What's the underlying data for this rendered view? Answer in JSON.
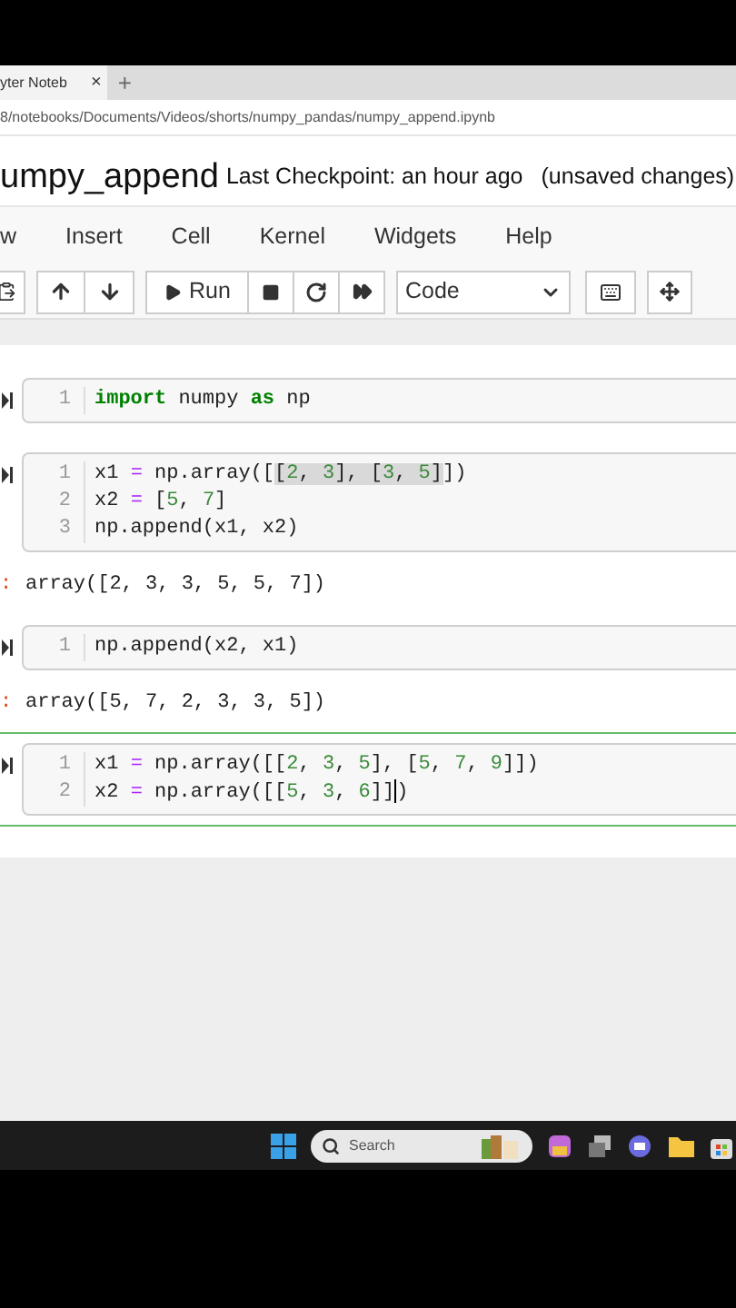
{
  "browser": {
    "tab": {
      "title": "yter Noteb",
      "close": "×"
    },
    "new_tab": "+",
    "url": "8/notebooks/Documents/Videos/shorts/numpy_pandas/numpy_append.ipynb"
  },
  "header": {
    "notebook_name": "umpy_append",
    "checkpoint": "Last Checkpoint: an hour ago",
    "status": "(unsaved changes)"
  },
  "menu": [
    "w",
    "Insert",
    "Cell",
    "Kernel",
    "Widgets",
    "Help"
  ],
  "toolbar": {
    "run_label": "Run",
    "cell_type": "Code"
  },
  "cells": [
    {
      "selected": false,
      "lines": [
        {
          "number": "1",
          "tokens": [
            {
              "kind": "keyword",
              "text": "import"
            },
            {
              "kind": "plain",
              "text": " numpy "
            },
            {
              "kind": "keyword",
              "text": "as"
            },
            {
              "kind": "plain",
              "text": " np"
            }
          ]
        }
      ]
    },
    {
      "selected": false,
      "lines": [
        {
          "number": "1",
          "tokens": [
            {
              "kind": "plain",
              "text": "x1 "
            },
            {
              "kind": "operator",
              "text": "="
            },
            {
              "kind": "plain",
              "text": " np.array(["
            },
            {
              "kind": "selection",
              "children": [
                {
                  "kind": "plain",
                  "text": "["
                },
                {
                  "kind": "number",
                  "text": "2"
                },
                {
                  "kind": "plain",
                  "text": ", "
                },
                {
                  "kind": "number",
                  "text": "3"
                },
                {
                  "kind": "plain",
                  "text": "], ["
                },
                {
                  "kind": "number",
                  "text": "3"
                },
                {
                  "kind": "plain",
                  "text": ", "
                },
                {
                  "kind": "number",
                  "text": "5"
                },
                {
                  "kind": "plain",
                  "text": "]"
                }
              ]
            },
            {
              "kind": "plain",
              "text": "])"
            }
          ]
        },
        {
          "number": "2",
          "tokens": [
            {
              "kind": "plain",
              "text": "x2 "
            },
            {
              "kind": "operator",
              "text": "="
            },
            {
              "kind": "plain",
              "text": " ["
            },
            {
              "kind": "number",
              "text": "5"
            },
            {
              "kind": "plain",
              "text": ", "
            },
            {
              "kind": "number",
              "text": "7"
            },
            {
              "kind": "plain",
              "text": "]"
            }
          ]
        },
        {
          "number": "3",
          "tokens": [
            {
              "kind": "plain",
              "text": "np.append(x1, x2)"
            }
          ]
        }
      ],
      "output": {
        "prompt": ":",
        "text": "array([2, 3, 3, 5, 5, 7])"
      }
    },
    {
      "selected": false,
      "lines": [
        {
          "number": "1",
          "tokens": [
            {
              "kind": "plain",
              "text": "np.append(x2, x1)"
            }
          ]
        }
      ],
      "output": {
        "prompt": ":",
        "text": "array([5, 7, 2, 3, 3, 5])"
      }
    },
    {
      "selected": true,
      "lines": [
        {
          "number": "1",
          "tokens": [
            {
              "kind": "plain",
              "text": "x1 "
            },
            {
              "kind": "operator",
              "text": "="
            },
            {
              "kind": "plain",
              "text": " np.array([["
            },
            {
              "kind": "number",
              "text": "2"
            },
            {
              "kind": "plain",
              "text": ", "
            },
            {
              "kind": "number",
              "text": "3"
            },
            {
              "kind": "plain",
              "text": ", "
            },
            {
              "kind": "number",
              "text": "5"
            },
            {
              "kind": "plain",
              "text": "], ["
            },
            {
              "kind": "number",
              "text": "5"
            },
            {
              "kind": "plain",
              "text": ", "
            },
            {
              "kind": "number",
              "text": "7"
            },
            {
              "kind": "plain",
              "text": ", "
            },
            {
              "kind": "number",
              "text": "9"
            },
            {
              "kind": "plain",
              "text": "]])"
            }
          ]
        },
        {
          "number": "2",
          "tokens": [
            {
              "kind": "plain",
              "text": "x2 "
            },
            {
              "kind": "operator",
              "text": "="
            },
            {
              "kind": "plain",
              "text": " np.array([["
            },
            {
              "kind": "number",
              "text": "5"
            },
            {
              "kind": "plain",
              "text": ", "
            },
            {
              "kind": "number",
              "text": "3"
            },
            {
              "kind": "plain",
              "text": ", "
            },
            {
              "kind": "number",
              "text": "6"
            },
            {
              "kind": "plain",
              "text": "]]"
            },
            {
              "kind": "cursor"
            },
            {
              "kind": "plain",
              "text": ")"
            }
          ]
        }
      ]
    }
  ],
  "taskbar": {
    "search_placeholder": "Search"
  }
}
